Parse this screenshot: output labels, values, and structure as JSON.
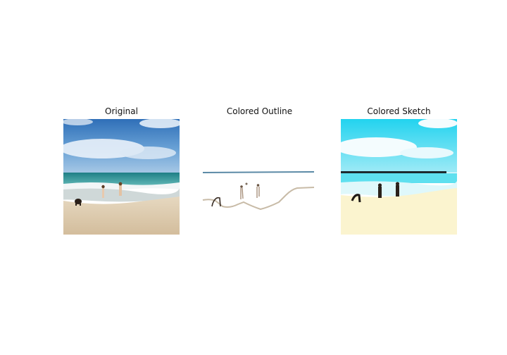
{
  "panels": [
    {
      "title": "Original"
    },
    {
      "title": "Colored Outline"
    },
    {
      "title": "Colored Sketch"
    }
  ],
  "colors": {
    "background": "#ffffff",
    "sky_top": "#2f6fb8",
    "sea": "#2a8f8c",
    "sand": "#d9c4a4",
    "sketch_sky": "#2fd6ef",
    "sketch_sand": "#fbf4cf",
    "outline_horizon": "#5b8aa6",
    "outline_shore": "#c8bba7"
  }
}
